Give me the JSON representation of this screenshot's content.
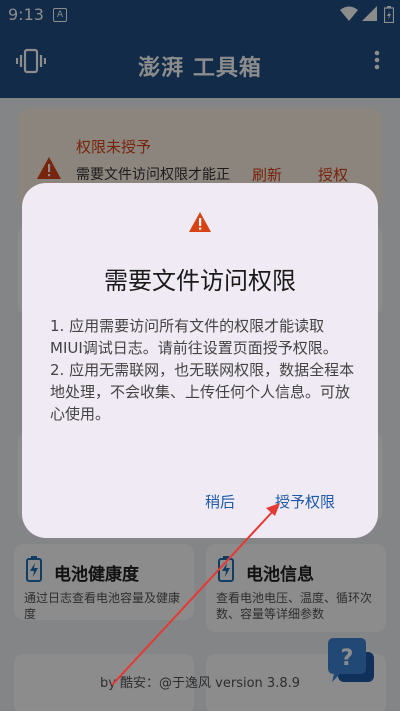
{
  "status_bar": {
    "time": "9:13",
    "notification_badge": "A"
  },
  "app_bar": {
    "title": "澎湃 工具箱"
  },
  "warning_card": {
    "title": "权限未授予",
    "description": "需要文件访问权限才能正",
    "refresh_label": "刷新",
    "grant_label": "授权"
  },
  "cards": [
    {
      "title": "电池健康度",
      "description": "通过日志查看电池容量及健康度"
    },
    {
      "title": "电池信息",
      "description": "查看电池电压、温度、循环次数、容量等详细参数"
    }
  ],
  "footer": {
    "text": "by 酷安：@于逸风 version 3.8.9"
  },
  "dialog": {
    "title": "需要文件访问权限",
    "body_1": "1. 应用需要访问所有文件的权限才能读取MIUI调试日志。请前往设置页面授予权限。",
    "body_2": "2. 应用无需联网，也无联网权限，数据全程本地处理，不会收集、上传任何个人信息。可放心使用。",
    "cancel_label": "稍后",
    "confirm_label": "授予权限"
  },
  "colors": {
    "primary": "#1f4f86",
    "warning": "#d84315",
    "link": "#1e5aa8",
    "dialog_bg": "#efeaf3",
    "annotation_arrow": "#e53935"
  }
}
